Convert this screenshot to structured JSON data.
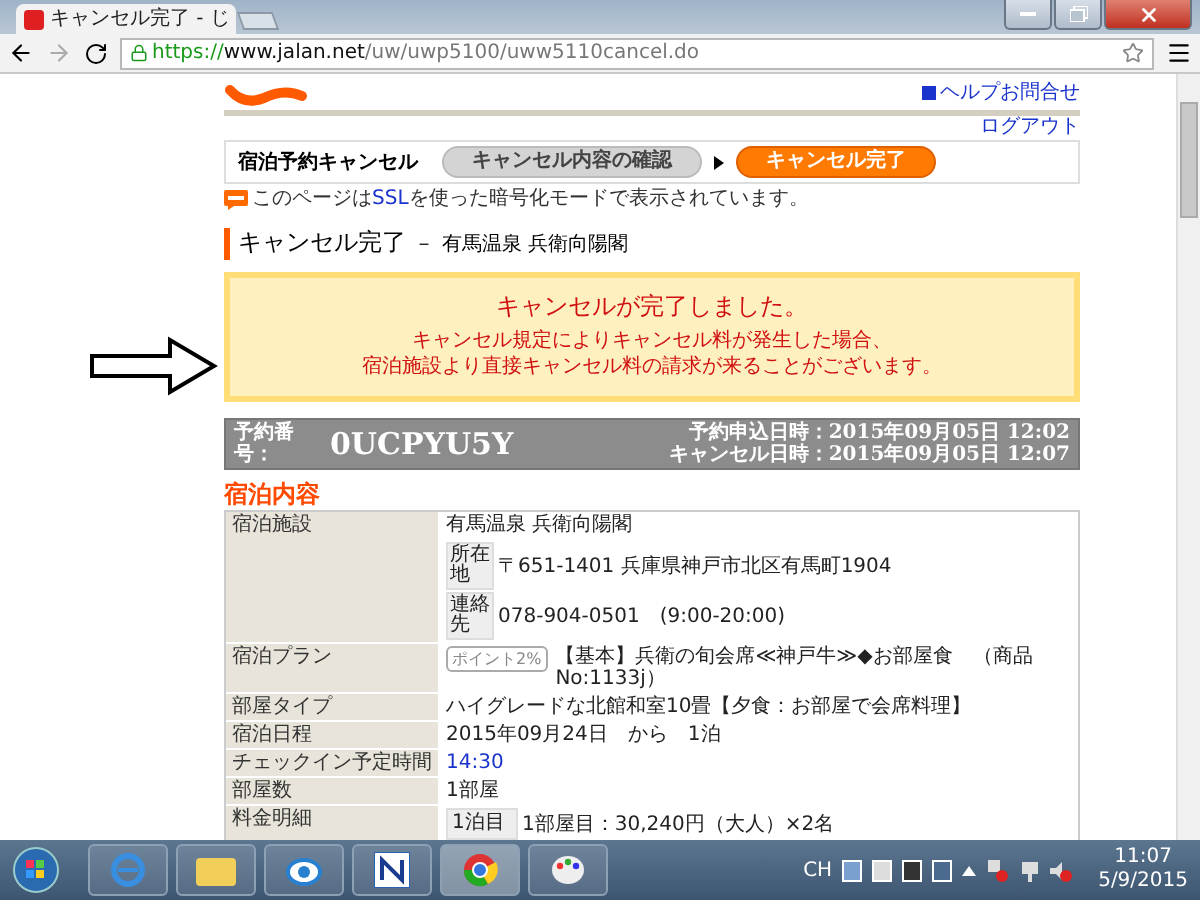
{
  "browser": {
    "tab_title": "キャンセル完了 - じ",
    "url": {
      "scheme": "https://",
      "host": "www.jalan.net",
      "path": "/uw/uwp5100/uww5110cancel.do"
    }
  },
  "header": {
    "help_link": "ヘルプお問合せ",
    "logout_link": "ログアウト"
  },
  "progress": {
    "label": "宿泊予約キャンセル",
    "steps": [
      {
        "label": "キャンセル内容の確認",
        "selected": false
      },
      {
        "label": "キャンセル完了",
        "selected": true
      }
    ]
  },
  "ssl_note": {
    "before": "このページは",
    "link": "SSL",
    "after": "を使った暗号化モードで表示されています。"
  },
  "heading": {
    "title": "キャンセル完了",
    "separator": "－",
    "hotel": "有馬温泉 兵衛向陽閣"
  },
  "notice": {
    "title": "キャンセルが完了しました。",
    "lines": [
      "キャンセル規定によりキャンセル料が発生した場合、",
      "宿泊施設より直接キャンセル料の請求が来ることがございます。"
    ]
  },
  "booking": {
    "number_label": "予約番号：",
    "number": "0UCPYU5Y",
    "dates": [
      "予約申込日時：2015年09月05日 12:02",
      "キャンセル日時：2015年09月05日 12:07"
    ]
  },
  "section_title": "宿泊内容",
  "rows": [
    {
      "kind": "facility",
      "label": "宿泊施設",
      "value": "有馬温泉 兵衛向陽閣",
      "details": [
        {
          "label": "所在地",
          "value": "〒651-1401 兵庫県神戸市北区有馬町1904"
        },
        {
          "label": "連絡先",
          "value": "078-904-0501　(9:00-20:00)"
        }
      ]
    },
    {
      "kind": "plan",
      "label": "宿泊プラン",
      "badge": "ポイント2%",
      "value": "【基本】兵衛の旬会席≪神戸牛≫◆お部屋食　（商品No:1133j）"
    },
    {
      "kind": "text",
      "label": "部屋タイプ",
      "value": "ハイグレードな北館和室10畳【夕食：お部屋で会席料理】"
    },
    {
      "kind": "text",
      "label": "宿泊日程",
      "value": "2015年09月24日　から　1泊"
    },
    {
      "kind": "link",
      "label": "チェックイン予定時間",
      "value": "14:30"
    },
    {
      "kind": "text",
      "label": "部屋数",
      "value": "1部屋"
    },
    {
      "kind": "fee",
      "label": "料金明細",
      "night": "1泊目",
      "value": "1部屋目：30,240円（大人）×2名"
    }
  ],
  "taskbar": {
    "language": "CH",
    "time": "11:07",
    "date": "5/9/2015"
  }
}
